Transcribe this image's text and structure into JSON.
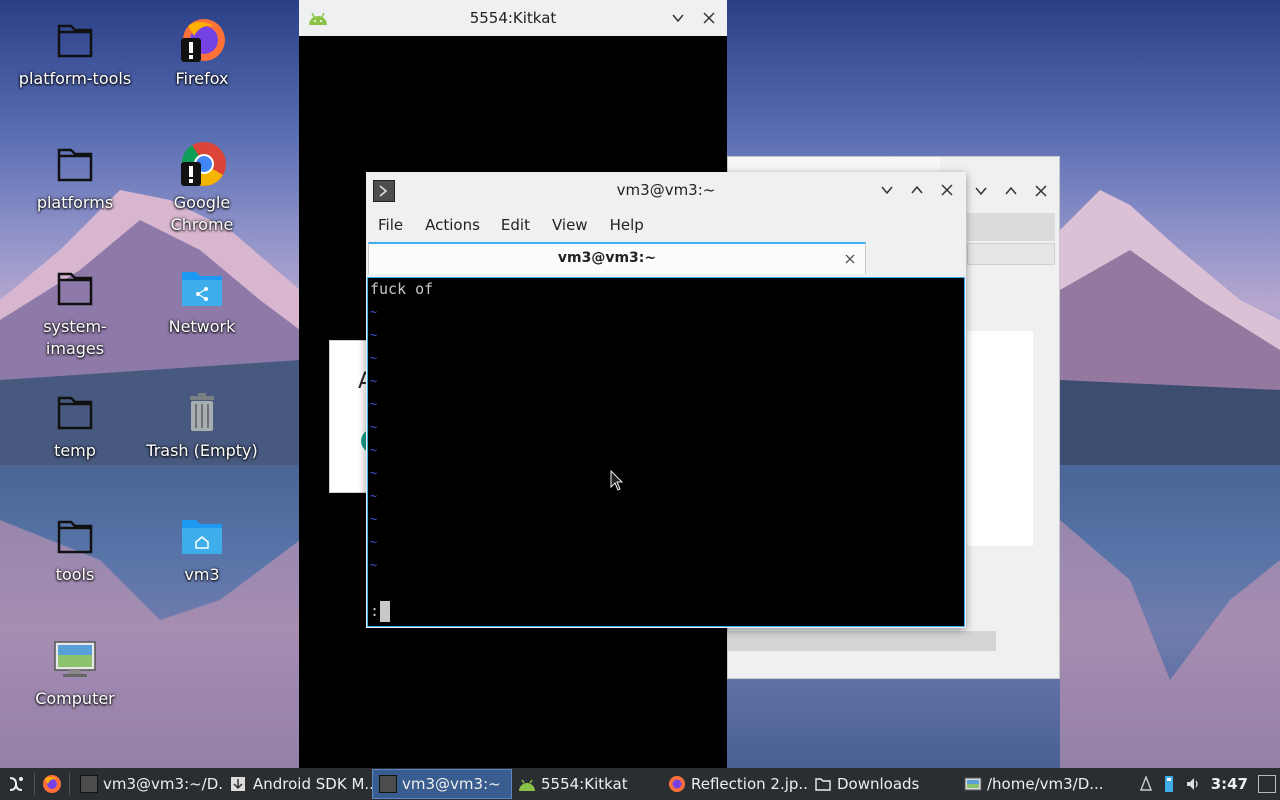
{
  "desktop": {
    "icons": [
      {
        "label": "platform-tools"
      },
      {
        "label": "Firefox"
      },
      {
        "label": "platforms"
      },
      {
        "label": "Google Chrome"
      },
      {
        "label": "system-images"
      },
      {
        "label": "Network"
      },
      {
        "label": "temp"
      },
      {
        "label": "Trash (Empty)"
      },
      {
        "label": "tools"
      },
      {
        "label": "vm3"
      },
      {
        "label": "Computer"
      }
    ]
  },
  "emulator_window": {
    "title": "5554:Kitkat"
  },
  "background_dialog": {
    "partial_letter": "A"
  },
  "terminal": {
    "title": "vm3@vm3:~",
    "menu": [
      "File",
      "Actions",
      "Edit",
      "View",
      "Help"
    ],
    "tab_label": "vm3@vm3:~",
    "first_line": "fuck of",
    "tilde": "~",
    "command_line": ":"
  },
  "taskbar": {
    "items": [
      {
        "label": "vm3@vm3:~/D..."
      },
      {
        "label": "Android SDK M..."
      },
      {
        "label": "vm3@vm3:~",
        "active": true
      },
      {
        "label": "5554:Kitkat"
      },
      {
        "label": "Reflection 2.jp..."
      },
      {
        "label": "Downloads"
      },
      {
        "label": "/home/vm3/D..."
      }
    ],
    "clock": "3:47"
  },
  "colors": {
    "terminal_bg": "#000000",
    "terminal_text": "#c8c8c8",
    "vi_tilde": "#3c52d9",
    "window_bg": "#eff0f1",
    "taskbar_bg": "#2b2e31",
    "accent": "#3daee9"
  }
}
